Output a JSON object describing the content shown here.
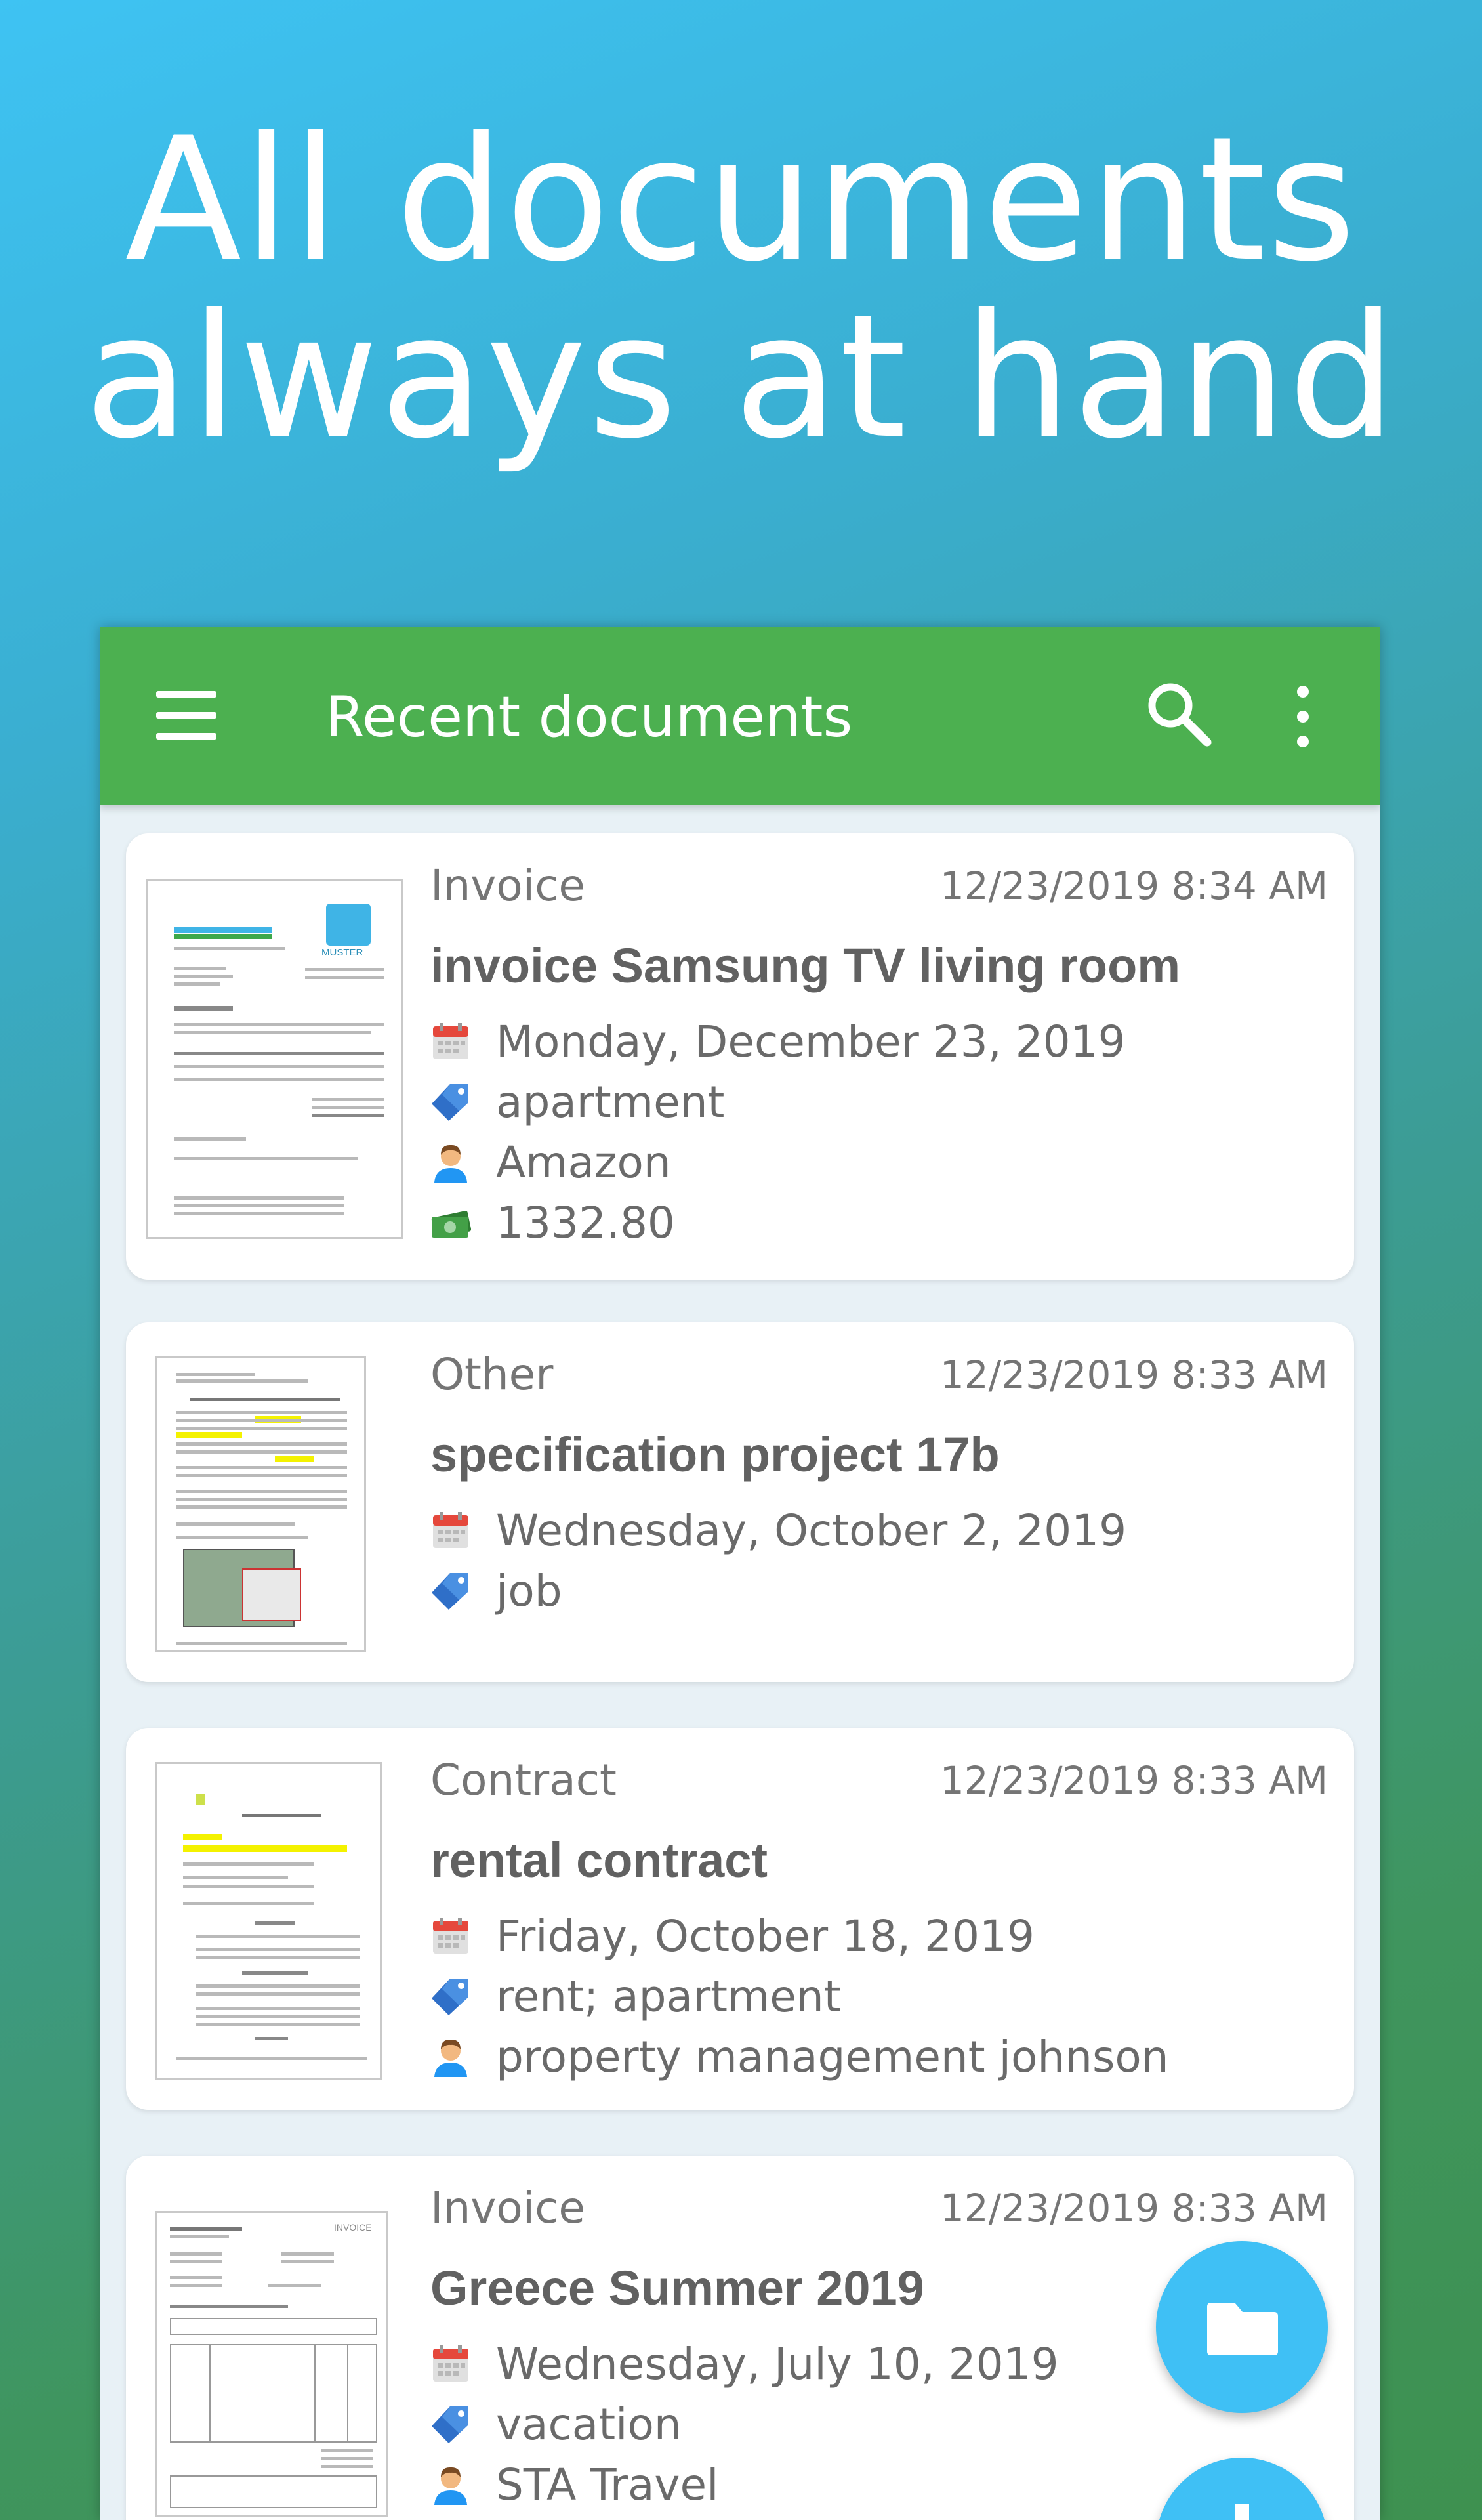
{
  "headline": {
    "line1": "All documents",
    "line2": "always at hand"
  },
  "appbar": {
    "title": "Recent documents",
    "menu_icon": "hamburger-menu-icon",
    "search_icon": "search-icon",
    "more_icon": "more-vert-icon",
    "color": "#4cb050"
  },
  "documents": [
    {
      "category": "Invoice",
      "timestamp": "12/23/2019 8:34 AM",
      "title": "invoice Samsung TV living room",
      "date": "Monday, December 23, 2019",
      "tags": "apartment",
      "contact": "Amazon",
      "amount": "1332.80"
    },
    {
      "category": "Other",
      "timestamp": "12/23/2019 8:33 AM",
      "title": "specification project 17b",
      "date": "Wednesday, October 2, 2019",
      "tags": "job"
    },
    {
      "category": "Contract",
      "timestamp": "12/23/2019 8:33 AM",
      "title": "rental contract",
      "date": "Friday, October 18, 2019",
      "tags": "rent; apartment",
      "contact": "property management johnson"
    },
    {
      "category": "Invoice",
      "timestamp": "12/23/2019 8:33 AM",
      "title": "Greece Summer 2019",
      "date": "Wednesday, July 10, 2019",
      "tags": "vacation",
      "contact": "STA Travel"
    }
  ],
  "fab": {
    "icon": "folder-icon",
    "color": "#3fc0f5"
  },
  "fab2": {
    "icon": "add-icon"
  },
  "thumbnail_texts": {
    "invoice_logo": "MUSTER",
    "greece_invoice": "INVOICE"
  },
  "icons": {
    "date": "calendar-icon",
    "tags": "tag-icon",
    "contact": "person-icon",
    "amount": "money-icon"
  }
}
